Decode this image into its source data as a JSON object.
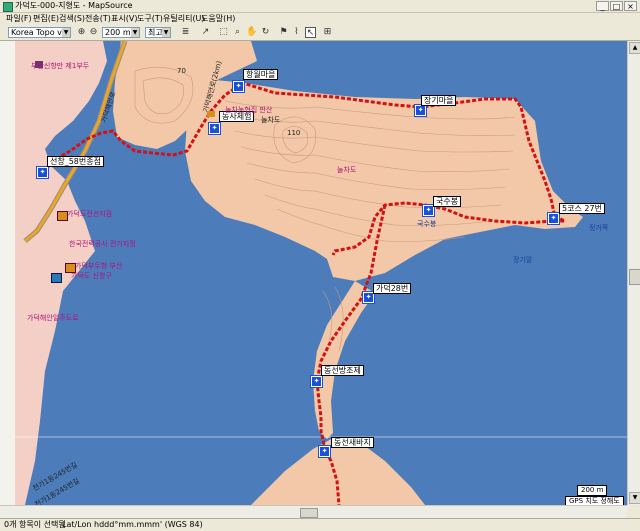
{
  "window": {
    "title": "가덕도-000-지형도 - MapSource",
    "min": "_",
    "max": "□",
    "close": "×"
  },
  "menu": [
    "파일(F)",
    "편집(E)",
    "검색(S)",
    "전송(T)",
    "표시(V)",
    "도구(T)",
    "유틸리티(U)",
    "도움말(H)"
  ],
  "toolbar": {
    "map_product": "Korea Topo v1",
    "zoom_scale": "200 m",
    "detail": "최고"
  },
  "waypoints": [
    {
      "label": "항월마을"
    },
    {
      "label": "장기마을"
    },
    {
      "label": "농사체험"
    },
    {
      "label": "선창_58번종점"
    },
    {
      "label": "국수봉"
    },
    {
      "label": "5코스 27번"
    },
    {
      "label": "가덕28번"
    },
    {
      "label": "동선방조제"
    },
    {
      "label": "동선새바지"
    }
  ],
  "map_labels": {
    "peak_70": "70",
    "peak_110": "110",
    "nuljado": "눌차도",
    "nuljado_2": "눌차도",
    "sinhang": "부산신항만 제1부두",
    "road_a": "가덕해안로",
    "road_b": "가덕해안로(2km)",
    "road_c": "가덕해안일주도로",
    "bus_a": "천가1동245번길",
    "bus_b": "천가1동245번길",
    "office": "가덕도전선지점",
    "school": "한국전력공사 전가지점",
    "market": "가덕부두형 부산",
    "church": "가덕도 신항구",
    "gooksu": "국수봉",
    "janggi": "장기말",
    "seodong": "정거쪽",
    "farm": "눌차농협집 판산"
  },
  "scale": {
    "label": "200 m"
  },
  "gps": {
    "label": "GPS 치도 정해도"
  },
  "status": {
    "selection": "0개 항목이 선택됨",
    "coords": "Lat/Lon hddd°mm.mmm' (WGS 84)"
  }
}
